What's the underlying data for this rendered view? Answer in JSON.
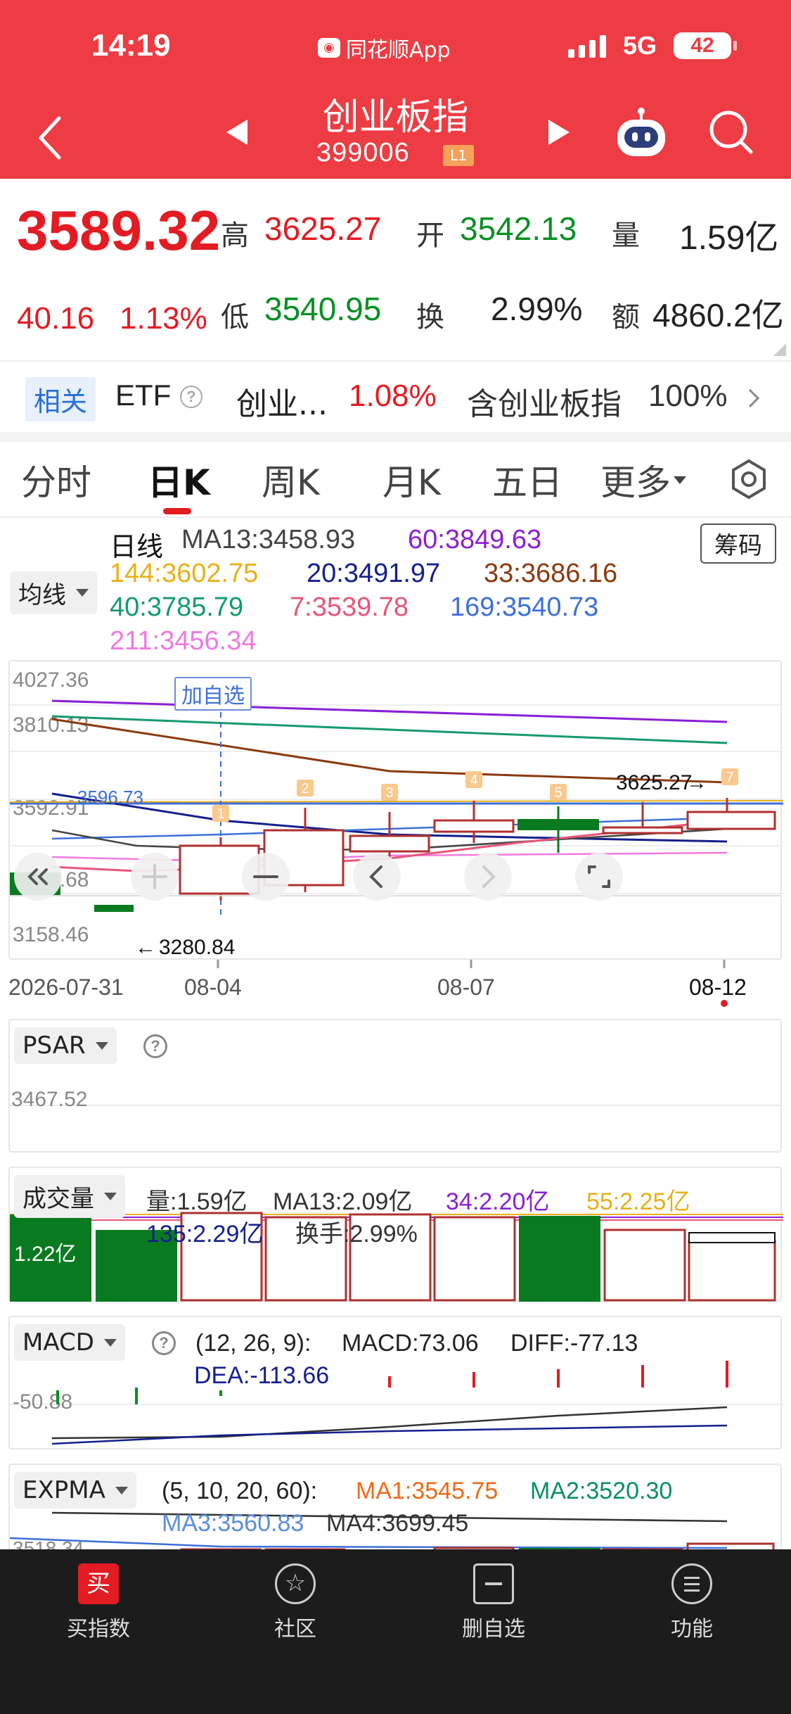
{
  "status_bar": {
    "time": "14:19",
    "app": "同花顺App",
    "network": "5G",
    "battery": "42"
  },
  "header": {
    "title": "创业板指",
    "code": "399006",
    "level": "L1"
  },
  "quote": {
    "price": "3589.32",
    "change": "40.16",
    "change_pct": "1.13%",
    "high_label": "高",
    "high": "3625.27",
    "open_label": "开",
    "open": "3542.13",
    "volume_label": "量",
    "volume": "1.59亿",
    "low_label": "低",
    "low": "3540.95",
    "turnover_label": "换",
    "turnover": "2.99%",
    "amount_label": "额",
    "amount": "4860.2亿"
  },
  "etf": {
    "badge": "相关",
    "label": "ETF",
    "name": "创业...",
    "pct": "1.08%",
    "contains": "含创业板指",
    "weight": "100%"
  },
  "tabs": [
    {
      "label": "分时"
    },
    {
      "label": "日K"
    },
    {
      "label": "周K"
    },
    {
      "label": "月K"
    },
    {
      "label": "五日"
    },
    {
      "label": "更多"
    }
  ],
  "ma": {
    "selector": "均线",
    "line_type": "日线",
    "chip_button": "筹码",
    "items": [
      {
        "text": "MA13:3458.93",
        "color": "#444444"
      },
      {
        "text": "60:3849.63",
        "color": "#8a1fd6"
      },
      {
        "text": "144:3602.75",
        "color": "#e8b01a"
      },
      {
        "text": "20:3491.97",
        "color": "#141f8c"
      },
      {
        "text": "33:3686.16",
        "color": "#8b3a0f"
      },
      {
        "text": "40:3785.79",
        "color": "#159a6e"
      },
      {
        "text": "7:3539.78",
        "color": "#e8557a"
      },
      {
        "text": "169:3540.73",
        "color": "#3d6fd9"
      },
      {
        "text": "211:3456.34",
        "color": "#f07ae0"
      }
    ]
  },
  "kchart": {
    "y_ticks": [
      "4027.36",
      "3810.13",
      "3592.91",
      "3375.68",
      "3158.46"
    ],
    "x_ticks": [
      "2026-07-31",
      "08-04",
      "08-07",
      "08-12"
    ],
    "current_price_label": "3596.73",
    "high_marker": "3625.27",
    "low_marker": "3280.84",
    "add_watchlist": "加自选",
    "event_badges": [
      "1",
      "2",
      "3",
      "4",
      "5",
      "7"
    ]
  },
  "psar": {
    "label": "PSAR",
    "value": "3467.52"
  },
  "volume": {
    "label": "成交量",
    "qty": "量:1.59亿",
    "ma13": "MA13:2.09亿",
    "ma34": "34:2.20亿",
    "ma55": "55:2.25亿",
    "ma135": "135:2.29亿",
    "turnover": "换手:2.99%",
    "y_tick": "1.22亿"
  },
  "macd": {
    "label": "MACD",
    "params": "(12, 26, 9):",
    "macd": "MACD:73.06",
    "diff": "DIFF:-77.13",
    "dea": "DEA:-113.66",
    "y_tick": "-50.88"
  },
  "expma": {
    "label": "EXPMA",
    "params": "(5, 10, 20, 60):",
    "ma1": "MA1:3545.75",
    "ma2": "MA2:3520.30",
    "ma3": "MA3:3560.83",
    "ma4": "MA4:3699.45",
    "y_tick": "3518.34"
  },
  "footer": [
    {
      "label": "买指数"
    },
    {
      "label": "社区"
    },
    {
      "label": "删自选"
    },
    {
      "label": "功能"
    }
  ],
  "colors": {
    "header": "#ed3c43",
    "up": "#e31b23",
    "down": "#0a8f23"
  }
}
